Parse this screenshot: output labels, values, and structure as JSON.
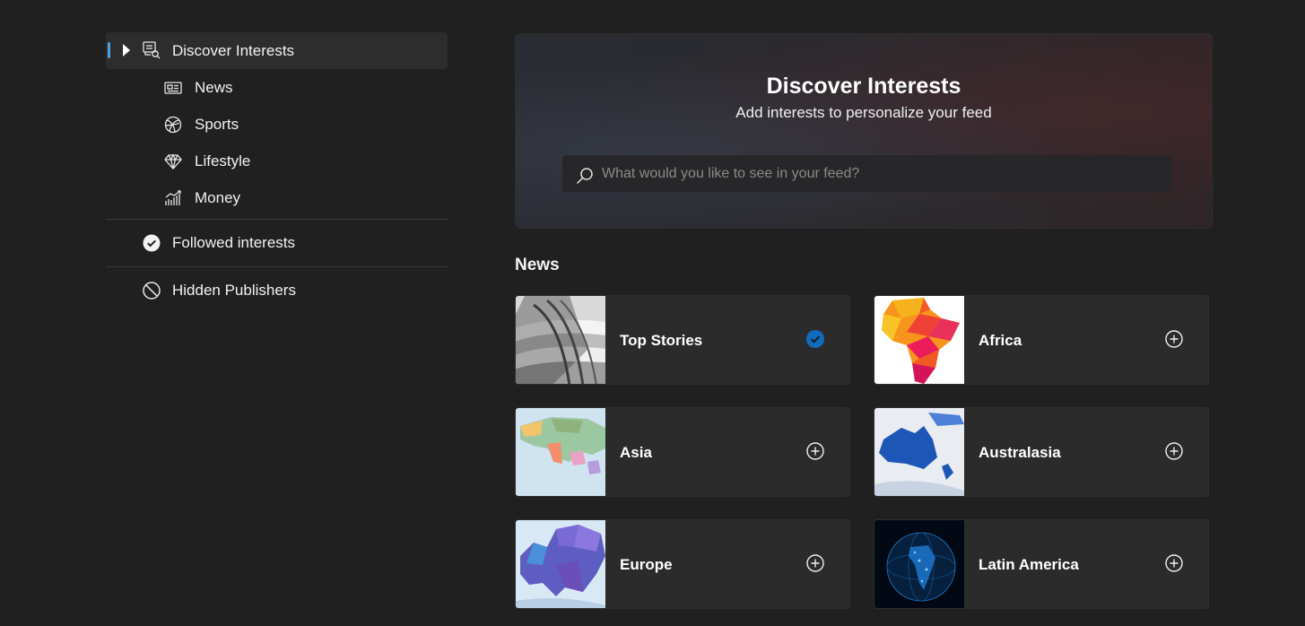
{
  "sidebar": {
    "discover": {
      "label": "Discover Interests",
      "icon": "discover-icon"
    },
    "categories": [
      {
        "label": "News",
        "icon": "newspaper-icon"
      },
      {
        "label": "Sports",
        "icon": "basketball-icon"
      },
      {
        "label": "Lifestyle",
        "icon": "diamond-icon"
      },
      {
        "label": "Money",
        "icon": "chart-icon"
      }
    ],
    "followed": {
      "label": "Followed interests",
      "icon": "check-circle-icon"
    },
    "hidden": {
      "label": "Hidden Publishers",
      "icon": "block-icon"
    }
  },
  "hero": {
    "title": "Discover Interests",
    "subtitle": "Add interests to personalize your feed",
    "search_placeholder": "What would you like to see in your feed?",
    "search_value": ""
  },
  "news_section": {
    "title": "News",
    "cards": [
      {
        "name": "Top Stories",
        "state": "followed"
      },
      {
        "name": "Africa",
        "state": "add"
      },
      {
        "name": "Asia",
        "state": "add"
      },
      {
        "name": "Australasia",
        "state": "add"
      },
      {
        "name": "Europe",
        "state": "add"
      },
      {
        "name": "Latin America",
        "state": "add"
      }
    ]
  },
  "colors": {
    "background": "#202020",
    "accent": "#4ca0e0",
    "followed_check": "#0f6cbd"
  }
}
